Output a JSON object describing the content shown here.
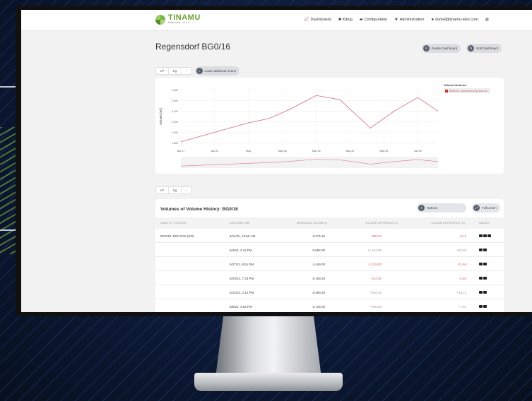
{
  "app": {
    "logo": "TINAMU",
    "logo_sub": "Dashboard · v2.0.8"
  },
  "nav": [
    {
      "icon": "chart-icon",
      "label": "Dashboards"
    },
    {
      "icon": "book-icon",
      "label": "Kibog"
    },
    {
      "icon": "folder-icon",
      "label": "Configuration"
    },
    {
      "icon": "star-icon",
      "label": "Administration"
    },
    {
      "icon": "user-icon",
      "label": "daniel@tinamu-labs.com"
    },
    {
      "icon": "globe-icon",
      "label": ""
    }
  ],
  "page": {
    "title": "Regensdorf BG0/16",
    "delete_label": "Delete Dashboard",
    "edit_label": "Edit Dashboard"
  },
  "toolbar": {
    "unit1": "m³",
    "unit2": "kg",
    "unit_more": "›",
    "load_label": "Load Additional Scans"
  },
  "legend": {
    "title": "Volume Histories",
    "entry": "BG0/16_unknown-new-end-id..."
  },
  "chart_data": {
    "type": "line",
    "ylabel": "Volume [m³]",
    "yticks": [
      "2,800",
      "2,600",
      "2,400",
      "2,200",
      "2,000",
      "1,800"
    ],
    "ylim": [
      1750,
      2850
    ],
    "categories": [
      "Apr 17",
      "Apr 24",
      "May",
      "May 08",
      "May 15",
      "May 22",
      "May 29",
      "Jun 05"
    ],
    "x": [
      0,
      1,
      2,
      2.6,
      3.2,
      4,
      4.7,
      5.6,
      6.3,
      7,
      7.6
    ],
    "values": [
      1820,
      2000,
      2180,
      2260,
      2430,
      2700,
      2620,
      2080,
      2400,
      2660,
      2400
    ],
    "series_color": "#d9788a",
    "grid": true
  },
  "table_toolbar": {
    "unit1": "m³",
    "unit2": "kg",
    "unit_more": "›"
  },
  "table": {
    "title": "Volumes of Volume History: BG0/16",
    "options_label": "Options",
    "fullscreen_label": "Fullscreen",
    "columns": [
      "NAME OF STORAGE",
      "DATE AND TIME",
      "MEASURED VOLUME (t)",
      "VOLUME DIFFERENCE (t)",
      "VOLUME DIFFERENCE (%)",
      "IMAGES"
    ],
    "rows": [
      {
        "name": "BG0/16: BG0 0/16 (RG)",
        "date": "6/11/22, 10:55 AM",
        "volume": "5,275.16",
        "diff": "-308.84",
        "diff_pct": "-6.11",
        "diff_class": "neg"
      },
      {
        "name": "",
        "date": "6/4/22, 2:11 PM",
        "volume": "5,584.00",
        "diff": "+1,134.00",
        "diff_pct": "+25.58",
        "diff_class": "pos"
      },
      {
        "name": "",
        "date": "5/27/22, 9:51 PM",
        "volume": "4,449.00",
        "diff": "-1,219.00",
        "diff_pct": "-21.58",
        "diff_class": "neg"
      },
      {
        "name": "",
        "date": "5/20/22, 7:33 PM",
        "volume": "6,159.20",
        "diff": "-224.00",
        "diff_pct": "-3.55",
        "diff_class": "neg"
      },
      {
        "name": "",
        "date": "5/14/22, 2:12 PM",
        "volume": "6,383.20",
        "diff": "+582.40",
        "diff_pct": "+10.11",
        "diff_class": "pos"
      },
      {
        "name": "",
        "date": "5/6/22, 3:53 PM",
        "volume": "5,724.00",
        "diff": "+405.00",
        "diff_pct": "+7.64",
        "diff_class": "pos"
      }
    ]
  }
}
